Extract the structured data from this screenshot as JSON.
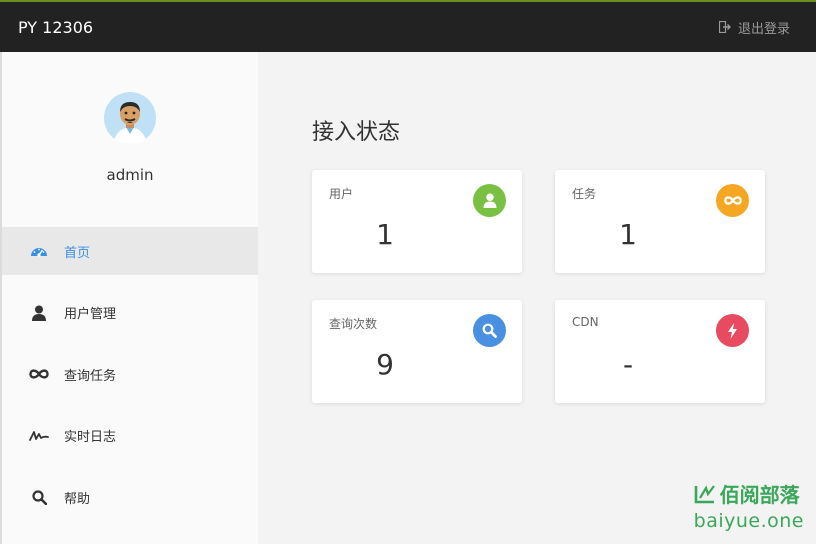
{
  "header": {
    "app_title": "PY 12306",
    "logout_label": "退出登录"
  },
  "sidebar": {
    "username": "admin",
    "items": [
      {
        "label": "首页",
        "icon": "dashboard-icon",
        "active": true
      },
      {
        "label": "用户管理",
        "icon": "user-icon"
      },
      {
        "label": "查询任务",
        "icon": "infinity-icon"
      },
      {
        "label": "实时日志",
        "icon": "signature-icon"
      },
      {
        "label": "帮助",
        "icon": "search-icon"
      }
    ]
  },
  "main": {
    "title": "接入状态",
    "cards": [
      {
        "label": "用户",
        "value": "1",
        "icon": "user-icon",
        "color": "#7ac143"
      },
      {
        "label": "任务",
        "value": "1",
        "icon": "infinity-icon",
        "color": "#f5a623"
      },
      {
        "label": "查询次数",
        "value": "9",
        "icon": "search-icon",
        "color": "#4a90e2"
      },
      {
        "label": "CDN",
        "value": "-",
        "icon": "bolt-icon",
        "color": "#e84a5f"
      }
    ]
  },
  "watermark": {
    "title": "佰阅部落",
    "url": "baiyue.one"
  },
  "colors": {
    "topbar": "#222222",
    "active_nav": "#3a8ee6",
    "watermark": "#3aa85a"
  }
}
